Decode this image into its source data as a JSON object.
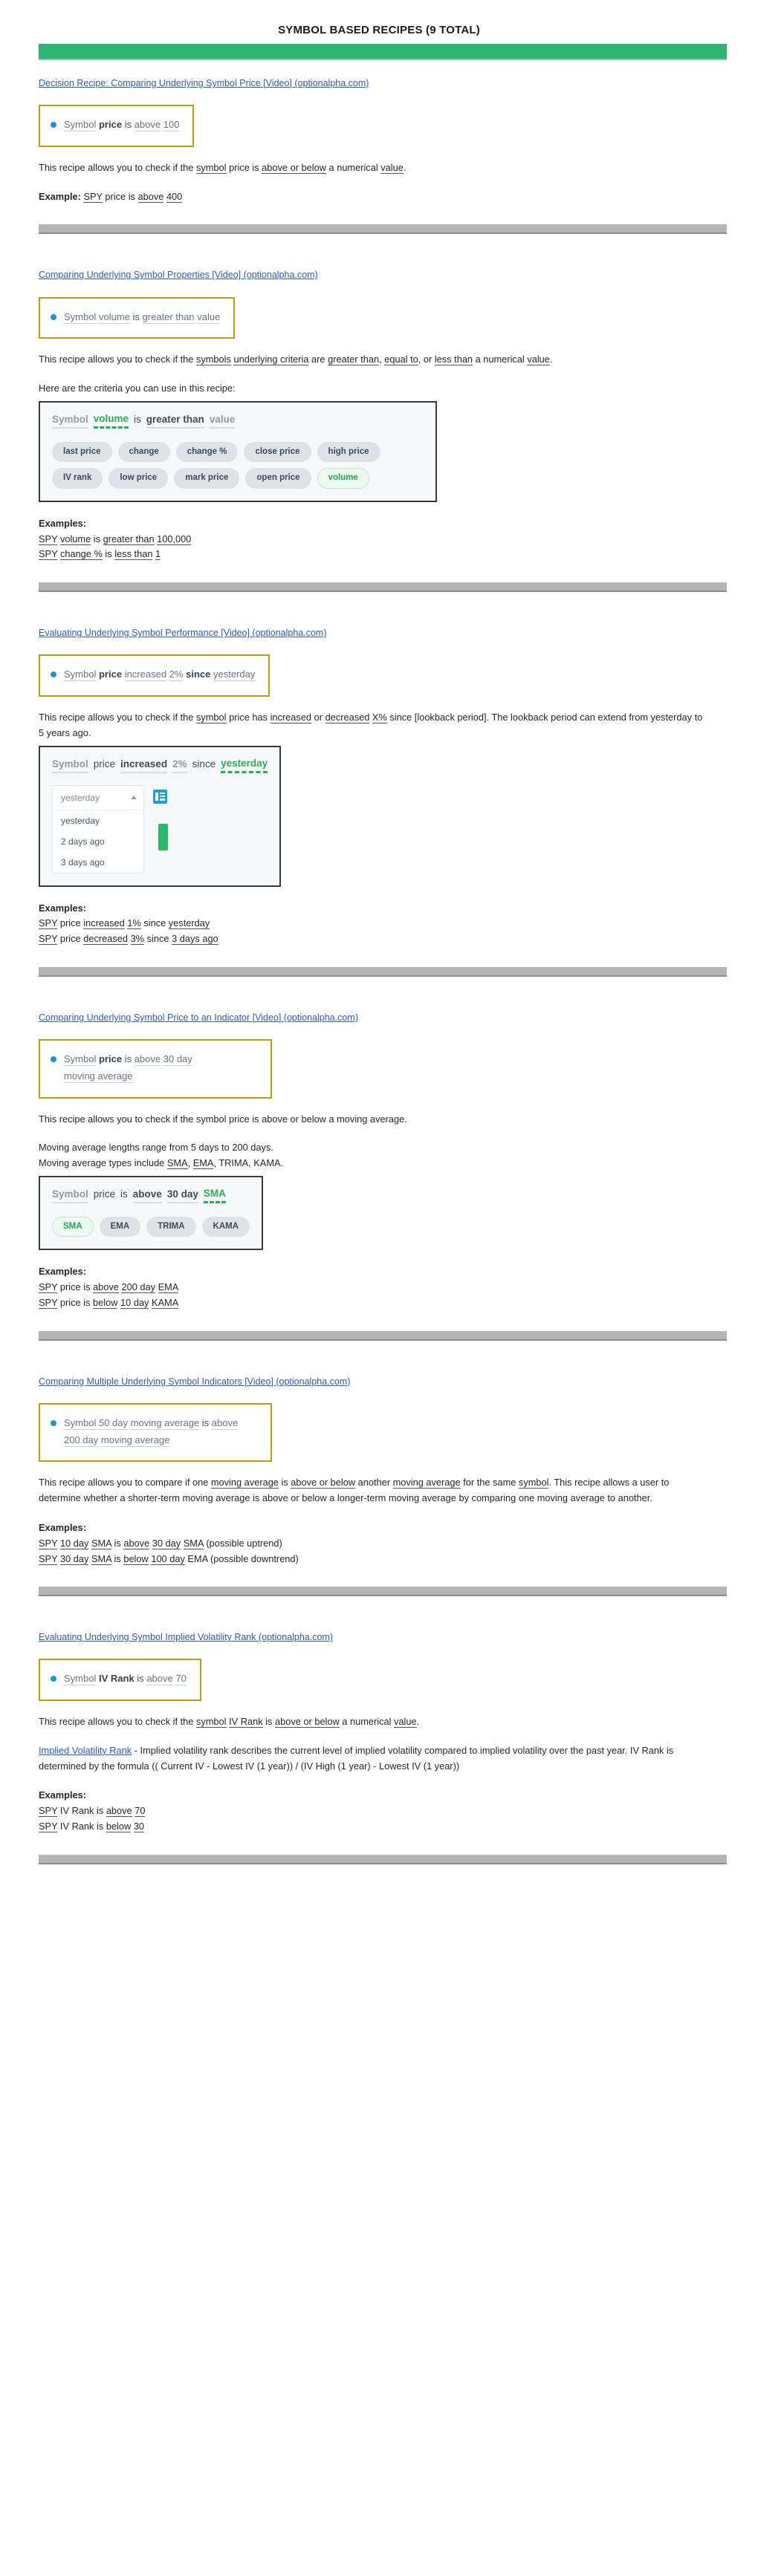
{
  "document": {
    "title": "SYMBOL BASED RECIPES (9 TOTAL)",
    "accent_green": "#2bb673",
    "separator_gray": "#b4b4b4",
    "card_border_gold": "#c99a07",
    "link_blue": "#2458d6",
    "active_green": "#22b14c",
    "bullet_blue": "#1b96d4"
  },
  "sections": [
    {
      "id": "comparing-underlying-symbol-price",
      "link": "Decision Recipe: Comparing Underlying Symbol Price [Video] (optionalpha.com)",
      "recipe": {
        "tokens": [
          {
            "text": "Symbol",
            "style": "underline"
          },
          {
            "text": "price",
            "style": "bold"
          },
          {
            "text": "is",
            "style": "plain"
          },
          {
            "text": "above",
            "style": "underline"
          },
          {
            "text": "100",
            "style": "underline"
          }
        ]
      },
      "description_parts": [
        {
          "text": "This recipe allows you to check if the ",
          "u": false
        },
        {
          "text": "symbol",
          "u": true
        },
        {
          "text": " price is ",
          "u": false
        },
        {
          "text": "above or below",
          "u": true
        },
        {
          "text": " a numerical ",
          "u": false
        },
        {
          "text": "value",
          "u": true
        },
        {
          "text": ".",
          "u": false
        }
      ],
      "example_label": "Example:",
      "example_inline_parts": [
        {
          "text": " ",
          "u": false
        },
        {
          "text": "SPY",
          "u": true
        },
        {
          "text": " price is ",
          "u": false
        },
        {
          "text": "above",
          "u": true
        },
        {
          "text": " ",
          "u": false
        },
        {
          "text": "400",
          "u": true
        }
      ]
    },
    {
      "id": "comparing-underlying-symbol-properties",
      "link": "Comparing Underlying Symbol Properties [Video] (optionalpha.com)",
      "recipe": {
        "tokens": [
          {
            "text": "Symbol",
            "style": "underline"
          },
          {
            "text": "volume",
            "style": "underline"
          },
          {
            "text": "is",
            "style": "plain"
          },
          {
            "text": "greater than",
            "style": "underline"
          },
          {
            "text": "value",
            "style": "underline"
          }
        ]
      },
      "description_parts": [
        {
          "text": "This recipe allows you to check if the ",
          "u": false
        },
        {
          "text": "symbols",
          "u": true
        },
        {
          "text": " ",
          "u": false
        },
        {
          "text": "underlying criteria",
          "u": true
        },
        {
          "text": " are ",
          "u": false
        },
        {
          "text": "greater than",
          "u": true
        },
        {
          "text": ", ",
          "u": false
        },
        {
          "text": "equal to",
          "u": true
        },
        {
          "text": ", or ",
          "u": false
        },
        {
          "text": "less than",
          "u": true
        },
        {
          "text": " a numerical ",
          "u": false
        },
        {
          "text": "value",
          "u": true
        },
        {
          "text": ".",
          "u": false
        }
      ],
      "criteria_intro": "Here are the criteria you can use in this recipe:",
      "screenshot": {
        "sentence": [
          {
            "text": "Symbol",
            "style": "symbol"
          },
          {
            "text": "volume",
            "style": "active"
          },
          {
            "text": "is",
            "style": "plain"
          },
          {
            "text": "greater than",
            "style": "slot"
          },
          {
            "text": "value",
            "style": "blue"
          }
        ],
        "chips": [
          {
            "label": "last price",
            "selected": false
          },
          {
            "label": "change",
            "selected": false
          },
          {
            "label": "change %",
            "selected": false
          },
          {
            "label": "close price",
            "selected": false
          },
          {
            "label": "high price",
            "selected": false
          },
          {
            "label": "IV rank",
            "selected": false
          },
          {
            "label": "low price",
            "selected": false
          },
          {
            "label": "mark price",
            "selected": false
          },
          {
            "label": "open price",
            "selected": false
          },
          {
            "label": "volume",
            "selected": true
          }
        ]
      },
      "examples_label": "Examples:",
      "examples": [
        [
          {
            "text": "SPY",
            "u": true
          },
          {
            "text": " ",
            "u": false
          },
          {
            "text": "volume",
            "u": true
          },
          {
            "text": " is ",
            "u": false
          },
          {
            "text": "greater than",
            "u": true
          },
          {
            "text": " ",
            "u": false
          },
          {
            "text": "100,000",
            "u": true
          }
        ],
        [
          {
            "text": "SPY",
            "u": true
          },
          {
            "text": " ",
            "u": false
          },
          {
            "text": "change %",
            "u": true
          },
          {
            "text": " is ",
            "u": false
          },
          {
            "text": "less than",
            "u": true
          },
          {
            "text": " ",
            "u": false
          },
          {
            "text": "1",
            "u": true
          }
        ]
      ]
    },
    {
      "id": "evaluating-underlying-symbol-performance",
      "link": "Evaluating Underlying Symbol Performance [Video] (optionalpha.com)",
      "recipe": {
        "tokens": [
          {
            "text": "Symbol",
            "style": "underline"
          },
          {
            "text": "price",
            "style": "bold"
          },
          {
            "text": "increased",
            "style": "underline"
          },
          {
            "text": "2%",
            "style": "underline"
          },
          {
            "text": "since",
            "style": "bold"
          },
          {
            "text": "yesterday",
            "style": "underline"
          }
        ]
      },
      "description_parts": [
        {
          "text": "This recipe allows you to check if the ",
          "u": false
        },
        {
          "text": "symbol",
          "u": true
        },
        {
          "text": " price has ",
          "u": false
        },
        {
          "text": "increased",
          "u": true
        },
        {
          "text": " or ",
          "u": false
        },
        {
          "text": "decreased",
          "u": true
        },
        {
          "text": " ",
          "u": false
        },
        {
          "text": "X%",
          "u": true
        },
        {
          "text": " since [lookback period]. The lookback period can extend from yesterday to 5 years ago.",
          "u": false
        }
      ],
      "screenshot": {
        "sentence": [
          {
            "text": "Symbol",
            "style": "symbol"
          },
          {
            "text": "price",
            "style": "plain"
          },
          {
            "text": "increased",
            "style": "slot"
          },
          {
            "text": "2%",
            "style": "blue"
          },
          {
            "text": "since",
            "style": "plain"
          },
          {
            "text": "yesterday",
            "style": "active"
          }
        ],
        "dropdown": {
          "value": "yesterday",
          "options": [
            "yesterday",
            "2 days ago",
            "3 days ago"
          ]
        },
        "list_icon": "list-icon"
      },
      "examples_label": "Examples:",
      "examples": [
        [
          {
            "text": "SPY",
            "u": true
          },
          {
            "text": " price ",
            "u": false
          },
          {
            "text": "increased",
            "u": true
          },
          {
            "text": " ",
            "u": false
          },
          {
            "text": "1%",
            "u": true
          },
          {
            "text": " since ",
            "u": false
          },
          {
            "text": "yesterday",
            "u": true
          }
        ],
        [
          {
            "text": "SPY",
            "u": true
          },
          {
            "text": " price ",
            "u": false
          },
          {
            "text": "decreased",
            "u": true
          },
          {
            "text": " ",
            "u": false
          },
          {
            "text": "3%",
            "u": true
          },
          {
            "text": " since ",
            "u": false
          },
          {
            "text": "3 days ago",
            "u": true
          }
        ]
      ]
    },
    {
      "id": "comparing-underlying-symbol-price-to-indicator",
      "link": "Comparing Underlying Symbol Price to an Indicator [Video] (optionalpha.com)",
      "recipe": {
        "tokens": [
          {
            "text": "Symbol",
            "style": "underline"
          },
          {
            "text": "price",
            "style": "bold"
          },
          {
            "text": "is",
            "style": "plain"
          },
          {
            "text": "above",
            "style": "underline"
          },
          {
            "text": "30 day",
            "style": "underline"
          },
          {
            "text": "moving average",
            "style": "underline"
          }
        ]
      },
      "description_parts": [
        {
          "text": "This recipe allows you to check if the symbol price is above or below a moving average.",
          "u": false
        }
      ],
      "extra_lines": [
        "Moving average lengths range from 5 days to 200 days.",
        "Moving average types include SMA, EMA, TRIMA, KAMA."
      ],
      "extra_line2_parts": [
        {
          "text": "Moving average types include ",
          "u": false
        },
        {
          "text": "SMA",
          "u": true
        },
        {
          "text": ", ",
          "u": false
        },
        {
          "text": "EMA",
          "u": true
        },
        {
          "text": ", TRIMA, KAMA.",
          "u": false
        }
      ],
      "screenshot": {
        "sentence": [
          {
            "text": "Symbol",
            "style": "symbol"
          },
          {
            "text": "price",
            "style": "plain"
          },
          {
            "text": "is",
            "style": "plain"
          },
          {
            "text": "above",
            "style": "slot"
          },
          {
            "text": "30 day",
            "style": "slot"
          },
          {
            "text": "SMA",
            "style": "active"
          }
        ],
        "chips": [
          {
            "label": "SMA",
            "selected": true
          },
          {
            "label": "EMA",
            "selected": false
          },
          {
            "label": "TRIMA",
            "selected": false
          },
          {
            "label": "KAMA",
            "selected": false
          }
        ]
      },
      "examples_label": "Examples:",
      "examples": [
        [
          {
            "text": "SPY",
            "u": true
          },
          {
            "text": " price is ",
            "u": false
          },
          {
            "text": "above",
            "u": true
          },
          {
            "text": " ",
            "u": false
          },
          {
            "text": "200 day",
            "u": true
          },
          {
            "text": " ",
            "u": false
          },
          {
            "text": "EMA",
            "u": true
          }
        ],
        [
          {
            "text": "SPY",
            "u": true
          },
          {
            "text": " price is ",
            "u": false
          },
          {
            "text": "below",
            "u": true
          },
          {
            "text": " ",
            "u": false
          },
          {
            "text": "10 day",
            "u": true
          },
          {
            "text": " ",
            "u": false
          },
          {
            "text": "KAMA",
            "u": true
          }
        ]
      ]
    },
    {
      "id": "comparing-multiple-underlying-symbol-indicators",
      "link": "Comparing Multiple Underlying Symbol Indicators [Video] (optionalpha.com)",
      "recipe": {
        "tokens": [
          {
            "text": "Symbol",
            "style": "underline"
          },
          {
            "text": "50 day",
            "style": "underline"
          },
          {
            "text": "moving average",
            "style": "underline"
          },
          {
            "text": "is",
            "style": "plain"
          },
          {
            "text": "above",
            "style": "underline"
          },
          {
            "text": "200 day",
            "style": "underline"
          },
          {
            "text": "moving average",
            "style": "underline"
          }
        ]
      },
      "description_parts": [
        {
          "text": "This recipe allows you to compare if one ",
          "u": false
        },
        {
          "text": "moving average",
          "u": true
        },
        {
          "text": " is ",
          "u": false
        },
        {
          "text": "above or below",
          "u": true
        },
        {
          "text": " another ",
          "u": false
        },
        {
          "text": "moving average",
          "u": true
        },
        {
          "text": " for the same ",
          "u": false
        },
        {
          "text": "symbol",
          "u": true
        },
        {
          "text": ". This recipe allows a user to determine whether a shorter-term moving average is above or below a longer-term moving average by comparing one moving average to another.",
          "u": false
        }
      ],
      "examples_label": "Examples:",
      "examples": [
        [
          {
            "text": "SPY",
            "u": true
          },
          {
            "text": " ",
            "u": false
          },
          {
            "text": "10 day",
            "u": true
          },
          {
            "text": " ",
            "u": false
          },
          {
            "text": "SMA",
            "u": true
          },
          {
            "text": " is ",
            "u": false
          },
          {
            "text": "above",
            "u": true
          },
          {
            "text": " ",
            "u": false
          },
          {
            "text": "30 day",
            "u": true
          },
          {
            "text": " ",
            "u": false
          },
          {
            "text": "SMA",
            "u": true
          },
          {
            "text": " (possible uptrend)",
            "u": false
          }
        ],
        [
          {
            "text": "SPY",
            "u": true
          },
          {
            "text": " ",
            "u": false
          },
          {
            "text": "30 day",
            "u": true
          },
          {
            "text": " ",
            "u": false
          },
          {
            "text": "SMA",
            "u": true
          },
          {
            "text": " is ",
            "u": false
          },
          {
            "text": "below",
            "u": true
          },
          {
            "text": " ",
            "u": false
          },
          {
            "text": "100 day",
            "u": true
          },
          {
            "text": " EMA (possible downtrend)",
            "u": false
          }
        ]
      ]
    },
    {
      "id": "evaluating-underlying-symbol-implied-volatility-rank",
      "link": "Evaluating Underlying Symbol Implied Volatility Rank (optionalpha.com)",
      "recipe": {
        "tokens": [
          {
            "text": "Symbol",
            "style": "underline"
          },
          {
            "text": "IV Rank",
            "style": "bold"
          },
          {
            "text": "is",
            "style": "plain"
          },
          {
            "text": "above",
            "style": "underline"
          },
          {
            "text": "70",
            "style": "underline"
          }
        ]
      },
      "description_parts": [
        {
          "text": "This recipe allows you to check if the ",
          "u": false
        },
        {
          "text": "symbol",
          "u": true
        },
        {
          "text": " ",
          "u": false
        },
        {
          "text": "IV Rank",
          "u": true
        },
        {
          "text": " is ",
          "u": false
        },
        {
          "text": "above or below",
          "u": true
        },
        {
          "text": " a numerical ",
          "u": false
        },
        {
          "text": "value",
          "u": true
        },
        {
          "text": ".",
          "u": false
        }
      ],
      "glossary": {
        "term": "Implied Volatility Rank",
        "body": " - Implied volatility rank describes the current level of implied volatility compared to implied volatility over the past year. IV Rank is determined by the formula (( Current IV - Lowest IV (1 year)) / (IV High (1 year) - Lowest IV (1 year))"
      },
      "examples_label": "Examples:",
      "examples": [
        [
          {
            "text": "SPY",
            "u": true
          },
          {
            "text": " IV Rank is ",
            "u": false
          },
          {
            "text": "above",
            "u": true
          },
          {
            "text": " ",
            "u": false
          },
          {
            "text": "70",
            "u": true
          }
        ],
        [
          {
            "text": "SPY",
            "u": true
          },
          {
            "text": " IV Rank is ",
            "u": false
          },
          {
            "text": "below",
            "u": true
          },
          {
            "text": " ",
            "u": false
          },
          {
            "text": "30",
            "u": true
          }
        ]
      ]
    }
  ]
}
